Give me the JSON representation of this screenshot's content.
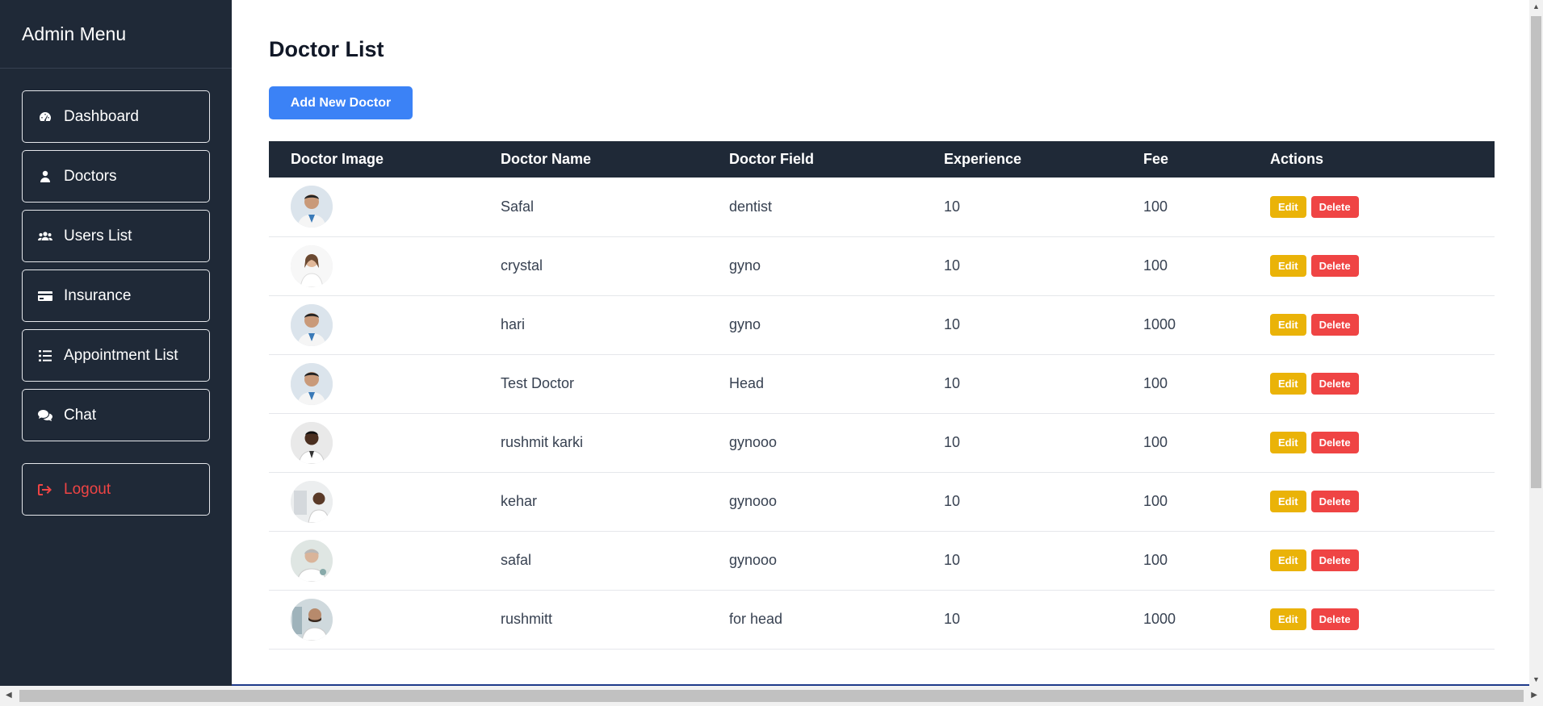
{
  "sidebar": {
    "title": "Admin Menu",
    "items": [
      {
        "label": "Dashboard",
        "icon": "dashboard-icon"
      },
      {
        "label": "Doctors",
        "icon": "doctor-icon"
      },
      {
        "label": "Users List",
        "icon": "users-icon"
      },
      {
        "label": "Insurance",
        "icon": "credit-card-icon"
      },
      {
        "label": "Appointment List",
        "icon": "list-icon"
      },
      {
        "label": "Chat",
        "icon": "chat-icon"
      }
    ],
    "logout_label": "Logout"
  },
  "main": {
    "title": "Doctor List",
    "add_button": "Add New Doctor",
    "table": {
      "headers": [
        "Doctor Image",
        "Doctor Name",
        "Doctor Field",
        "Experience",
        "Fee",
        "Actions"
      ],
      "rows": [
        {
          "name": "Safal",
          "field": "dentist",
          "experience": "10",
          "fee": "100"
        },
        {
          "name": "crystal",
          "field": "gyno",
          "experience": "10",
          "fee": "100"
        },
        {
          "name": "hari",
          "field": "gyno",
          "experience": "10",
          "fee": "1000"
        },
        {
          "name": "Test Doctor",
          "field": "Head",
          "experience": "10",
          "fee": "100"
        },
        {
          "name": "rushmit karki",
          "field": "gynooo",
          "experience": "10",
          "fee": "100"
        },
        {
          "name": "kehar",
          "field": "gynooo",
          "experience": "10",
          "fee": "100"
        },
        {
          "name": "safal",
          "field": "gynooo",
          "experience": "10",
          "fee": "100"
        },
        {
          "name": "rushmitt",
          "field": "for head",
          "experience": "10",
          "fee": "1000"
        }
      ],
      "edit_label": "Edit",
      "delete_label": "Delete"
    }
  },
  "colors": {
    "sidebar_bg": "#1f2937",
    "primary": "#3b82f6",
    "edit": "#eab308",
    "delete": "#ef4444"
  }
}
